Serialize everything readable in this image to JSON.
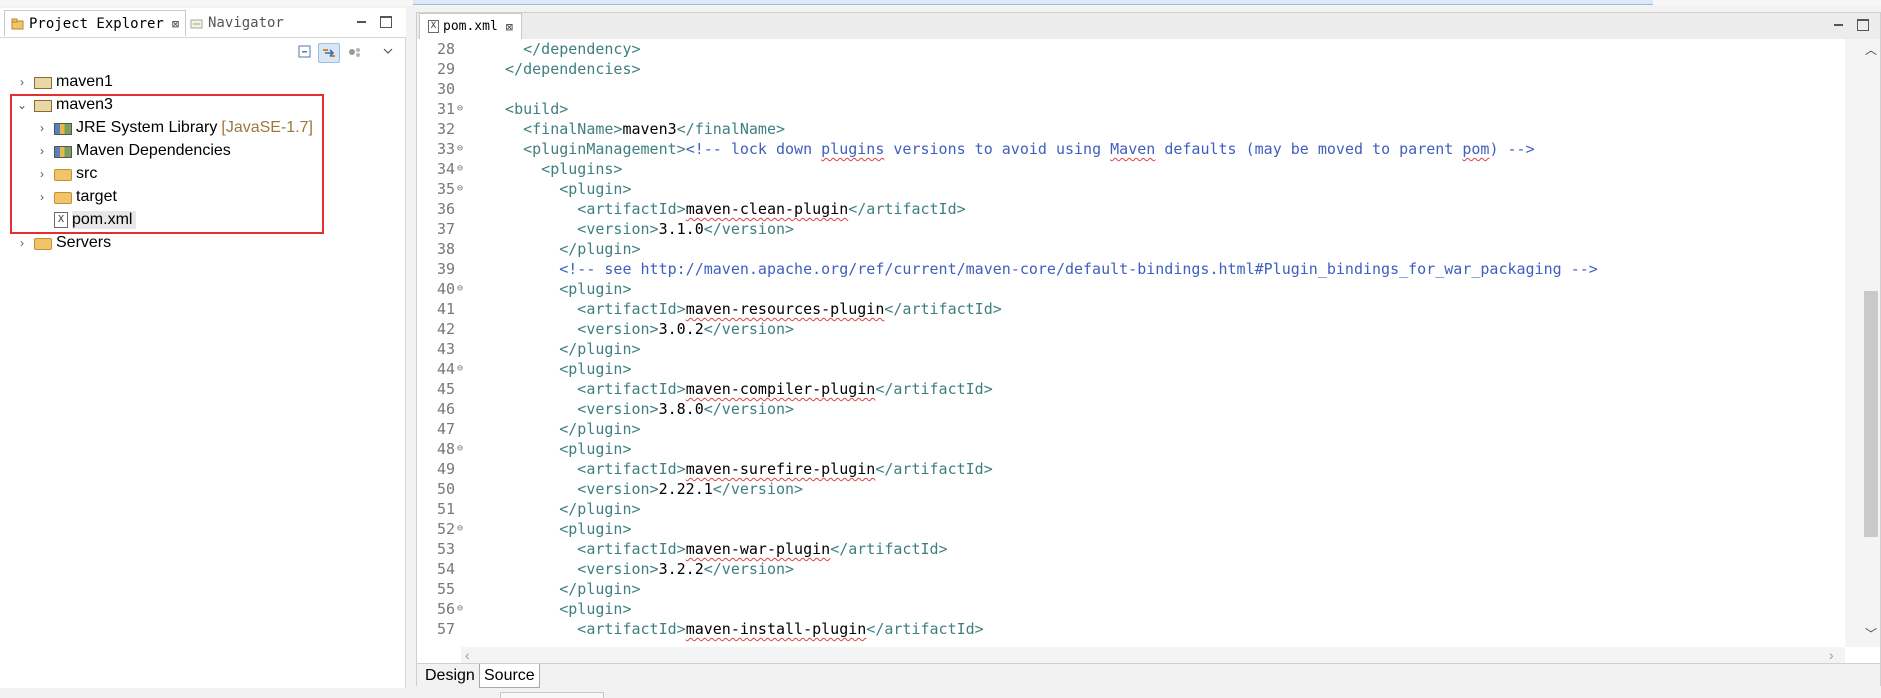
{
  "explorer": {
    "tabs": [
      {
        "label": "Project Explorer",
        "close": "⊠"
      },
      {
        "label": "Navigator"
      }
    ],
    "tree": [
      {
        "label": "maven1",
        "twisty": "›",
        "icon": "maven-project-icon"
      },
      {
        "label": "maven3",
        "twisty": "⌄",
        "icon": "maven-project-icon"
      },
      {
        "label": "JRE System Library",
        "decoration": "[JavaSE-1.7]",
        "twisty": "›",
        "icon": "library-icon"
      },
      {
        "label": "Maven Dependencies",
        "twisty": "›",
        "icon": "library-icon"
      },
      {
        "label": "src",
        "twisty": "›",
        "icon": "folder-icon"
      },
      {
        "label": "target",
        "twisty": "›",
        "icon": "folder-icon"
      },
      {
        "label": "pom.xml",
        "twisty": "",
        "icon": "xml-file-icon"
      },
      {
        "label": "Servers",
        "twisty": "›",
        "icon": "folder-icon"
      }
    ]
  },
  "editor": {
    "tab": {
      "label": "pom.xml",
      "close": "⊠"
    },
    "page_tabs": {
      "design": "Design",
      "source": "Source"
    },
    "lines": [
      {
        "n": "28",
        "fold": "",
        "parts": [
          [
            "t",
            "    </dependency>"
          ]
        ]
      },
      {
        "n": "29",
        "fold": "",
        "parts": [
          [
            "t",
            "  </dependencies>"
          ]
        ]
      },
      {
        "n": "30",
        "fold": "",
        "parts": [
          [
            "x",
            ""
          ]
        ]
      },
      {
        "n": "31",
        "fold": "⊖",
        "parts": [
          [
            "t",
            "  <build>"
          ]
        ]
      },
      {
        "n": "32",
        "fold": "",
        "parts": [
          [
            "t",
            "    <finalName>"
          ],
          [
            "x",
            "maven3"
          ],
          [
            "t",
            "</finalName>"
          ]
        ]
      },
      {
        "n": "33",
        "fold": "⊖",
        "parts": [
          [
            "t",
            "    <pluginManagement>"
          ],
          [
            "c",
            "<!-- lock down "
          ],
          [
            "cs",
            "plugins"
          ],
          [
            "c",
            " versions to avoid using "
          ],
          [
            "cs",
            "Maven"
          ],
          [
            "c",
            " defaults (may be moved to parent "
          ],
          [
            "cs",
            "pom"
          ],
          [
            "c",
            ") -->"
          ]
        ]
      },
      {
        "n": "34",
        "fold": "⊖",
        "parts": [
          [
            "t",
            "      <plugins>"
          ]
        ]
      },
      {
        "n": "35",
        "fold": "⊖",
        "parts": [
          [
            "t",
            "        <plugin>"
          ]
        ]
      },
      {
        "n": "36",
        "fold": "",
        "parts": [
          [
            "t",
            "          <artifactId>"
          ],
          [
            "xs",
            "maven-clean-plugin"
          ],
          [
            "t",
            "</artifactId>"
          ]
        ]
      },
      {
        "n": "37",
        "fold": "",
        "parts": [
          [
            "t",
            "          <version>"
          ],
          [
            "x",
            "3.1.0"
          ],
          [
            "t",
            "</version>"
          ]
        ]
      },
      {
        "n": "38",
        "fold": "",
        "parts": [
          [
            "t",
            "        </plugin>"
          ]
        ]
      },
      {
        "n": "39",
        "fold": "",
        "parts": [
          [
            "c",
            "        <!-- see http://maven.apache.org/ref/current/maven-core/default-bindings.html#Plugin_bindings_for_war_packaging -->"
          ]
        ]
      },
      {
        "n": "40",
        "fold": "⊖",
        "parts": [
          [
            "t",
            "        <plugin>"
          ]
        ]
      },
      {
        "n": "41",
        "fold": "",
        "parts": [
          [
            "t",
            "          <artifactId>"
          ],
          [
            "xs",
            "maven-resources-plugin"
          ],
          [
            "t",
            "</artifactId>"
          ]
        ]
      },
      {
        "n": "42",
        "fold": "",
        "parts": [
          [
            "t",
            "          <version>"
          ],
          [
            "x",
            "3.0.2"
          ],
          [
            "t",
            "</version>"
          ]
        ]
      },
      {
        "n": "43",
        "fold": "",
        "parts": [
          [
            "t",
            "        </plugin>"
          ]
        ]
      },
      {
        "n": "44",
        "fold": "⊖",
        "parts": [
          [
            "t",
            "        <plugin>"
          ]
        ]
      },
      {
        "n": "45",
        "fold": "",
        "parts": [
          [
            "t",
            "          <artifactId>"
          ],
          [
            "xs",
            "maven-compiler-plugin"
          ],
          [
            "t",
            "</artifactId>"
          ]
        ]
      },
      {
        "n": "46",
        "fold": "",
        "parts": [
          [
            "t",
            "          <version>"
          ],
          [
            "x",
            "3.8.0"
          ],
          [
            "t",
            "</version>"
          ]
        ]
      },
      {
        "n": "47",
        "fold": "",
        "parts": [
          [
            "t",
            "        </plugin>"
          ]
        ]
      },
      {
        "n": "48",
        "fold": "⊖",
        "parts": [
          [
            "t",
            "        <plugin>"
          ]
        ]
      },
      {
        "n": "49",
        "fold": "",
        "parts": [
          [
            "t",
            "          <artifactId>"
          ],
          [
            "xs",
            "maven-surefire-plugin"
          ],
          [
            "t",
            "</artifactId>"
          ]
        ]
      },
      {
        "n": "50",
        "fold": "",
        "parts": [
          [
            "t",
            "          <version>"
          ],
          [
            "x",
            "2.22.1"
          ],
          [
            "t",
            "</version>"
          ]
        ]
      },
      {
        "n": "51",
        "fold": "",
        "parts": [
          [
            "t",
            "        </plugin>"
          ]
        ]
      },
      {
        "n": "52",
        "fold": "⊖",
        "parts": [
          [
            "t",
            "        <plugin>"
          ]
        ]
      },
      {
        "n": "53",
        "fold": "",
        "parts": [
          [
            "t",
            "          <artifactId>"
          ],
          [
            "xs",
            "maven-war-plugin"
          ],
          [
            "t",
            "</artifactId>"
          ]
        ]
      },
      {
        "n": "54",
        "fold": "",
        "parts": [
          [
            "t",
            "          <version>"
          ],
          [
            "x",
            "3.2.2"
          ],
          [
            "t",
            "</version>"
          ]
        ]
      },
      {
        "n": "55",
        "fold": "",
        "parts": [
          [
            "t",
            "        </plugin>"
          ]
        ]
      },
      {
        "n": "56",
        "fold": "⊖",
        "parts": [
          [
            "t",
            "        <plugin>"
          ]
        ]
      },
      {
        "n": "57",
        "fold": "",
        "parts": [
          [
            "t",
            "          <artifactId>"
          ],
          [
            "xs",
            "maven-install-plugin"
          ],
          [
            "t",
            "</artifactId>"
          ]
        ]
      }
    ]
  }
}
